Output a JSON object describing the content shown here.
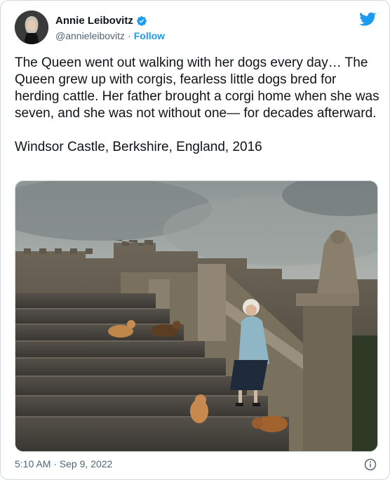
{
  "author": {
    "name": "Annie Leibovitz",
    "handle": "@annieleibovitz",
    "follow_label": "Follow",
    "separator": "·"
  },
  "icons": {
    "verified": "verified-badge-icon",
    "brand": "twitter-bird-icon",
    "info": "info-icon"
  },
  "colors": {
    "accent": "#1d9bf0",
    "secondary_text": "#536471",
    "primary_text": "#0f1419"
  },
  "tweet": {
    "paragraph_1": "The Queen went out walking with her dogs every day… The Queen grew up with corgis, fearless little dogs bred for herding cattle. Her father brought a corgi home when she was seven, and she was not without one— for decades afterward.",
    "paragraph_2": "Windsor Castle, Berkshire, England, 2016"
  },
  "footer": {
    "timestamp": "5:10 AM · Sep 9, 2022"
  }
}
